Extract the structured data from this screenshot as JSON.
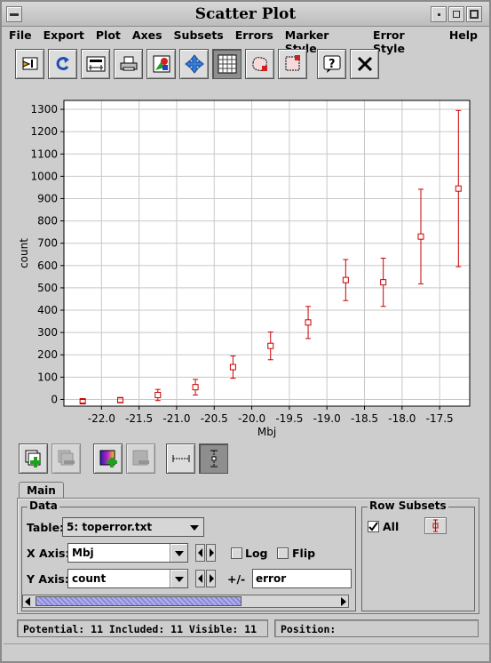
{
  "window": {
    "title": "Scatter Plot"
  },
  "menu": [
    "File",
    "Export",
    "Plot",
    "Axes",
    "Subsets",
    "Errors",
    "Marker Style",
    "Error Style",
    "Help"
  ],
  "toolbar_icons": [
    "replot-icon",
    "rescale-icon",
    "axis-labels-icon",
    "print-icon",
    "image-export-icon",
    "navigate-icon",
    "grid-icon",
    "subset-from-region-icon",
    "subset-from-visible-icon",
    "help-icon",
    "close-icon"
  ],
  "chart_data": {
    "type": "scatter",
    "xlabel": "Mbj",
    "ylabel": "count",
    "xlim": [
      -22.5,
      -17.1
    ],
    "ylim": [
      -30,
      1340
    ],
    "xticks": [
      -22.0,
      -21.5,
      -21.0,
      -20.5,
      -20.0,
      -19.5,
      -19.0,
      -18.5,
      -18.0,
      -17.5
    ],
    "xtick_labels": [
      "-22.0",
      "-21.5",
      "-21.0",
      "-20.5",
      "-20.0",
      "-19.5",
      "-19.0",
      "-18.5",
      "-18.0",
      "-17.5"
    ],
    "yticks": [
      0,
      100,
      200,
      300,
      400,
      500,
      600,
      700,
      800,
      900,
      1000,
      1100,
      1200,
      1300
    ],
    "ytick_labels": [
      "0",
      "100",
      "200",
      "300",
      "400",
      "500",
      "600",
      "700",
      "800",
      "900",
      "1000",
      "1100",
      "1200",
      "1300"
    ],
    "grid": true,
    "marker_color": "#cc0000",
    "series": [
      {
        "x": [
          -22.25,
          -21.75,
          -21.25,
          -20.75,
          -20.25,
          -19.75,
          -19.25,
          -18.75,
          -18.25,
          -17.75,
          -17.25
        ],
        "y": [
          -8,
          -3,
          20,
          55,
          145,
          240,
          345,
          535,
          525,
          730,
          945
        ],
        "err": [
          8,
          10,
          25,
          35,
          50,
          62,
          72,
          92,
          108,
          212,
          350
        ]
      }
    ]
  },
  "tab": {
    "main": "Main"
  },
  "data_panel": {
    "title": "Data",
    "table_label": "Table:",
    "table_value": "5: toperror.txt",
    "xaxis_label": "X Axis:",
    "xaxis_value": "Mbj",
    "log_label": "Log",
    "flip_label": "Flip",
    "yaxis_label": "Y Axis:",
    "yaxis_value": "count",
    "plusminus_label": "+/-",
    "error_value": "error"
  },
  "row_subsets": {
    "title": "Row Subsets",
    "all_label": "All"
  },
  "status": {
    "counts": "Potential: 11 Included: 11 Visible: 11",
    "position": "Position:"
  }
}
